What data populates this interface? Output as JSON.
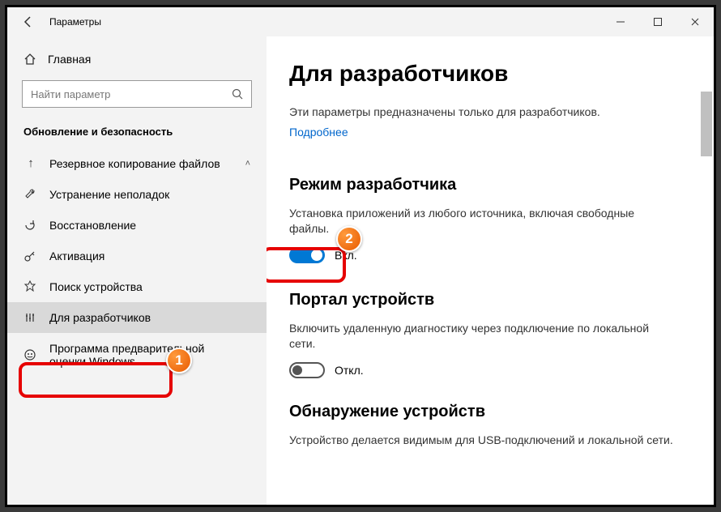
{
  "window": {
    "title": "Параметры"
  },
  "sidebar": {
    "home": "Главная",
    "search_placeholder": "Найти параметр",
    "section": "Обновление и безопасность",
    "items": [
      {
        "label": "Резервное копирование файлов",
        "icon": "↑",
        "expanded": true
      },
      {
        "label": "Устранение неполадок",
        "icon": "wrench"
      },
      {
        "label": "Восстановление",
        "icon": "recovery"
      },
      {
        "label": "Активация",
        "icon": "key"
      },
      {
        "label": "Поиск устройства",
        "icon": "find"
      },
      {
        "label": "Для разработчиков",
        "icon": "dev",
        "selected": true
      },
      {
        "label": "Программа предварительной оценки Windows",
        "icon": "insider"
      }
    ]
  },
  "main": {
    "heading": "Для разработчиков",
    "intro": "Эти параметры предназначены только для разработчиков.",
    "link": "Подробнее",
    "sec1": {
      "title": "Режим разработчика",
      "desc": "Установка приложений из любого источника, включая свободные файлы.",
      "toggle_label": "Вкл."
    },
    "sec2": {
      "title": "Портал устройств",
      "desc": "Включить удаленную диагностику через подключение по локальной сети.",
      "toggle_label": "Откл."
    },
    "sec3": {
      "title": "Обнаружение устройств",
      "desc": "Устройство делается видимым для USB-подключений и локальной сети."
    }
  },
  "annotations": {
    "b1": "1",
    "b2": "2"
  }
}
